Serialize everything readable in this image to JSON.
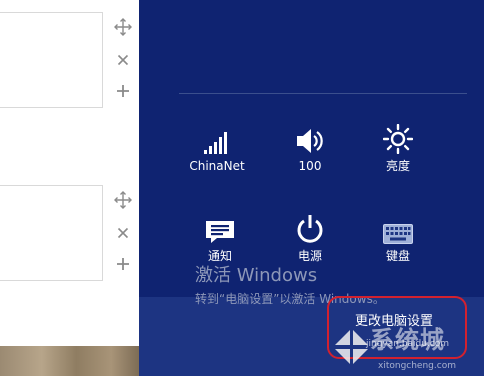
{
  "left_pane": {
    "tile_controls": [
      "move-icon",
      "close-icon",
      "add-icon"
    ]
  },
  "settings_charm": {
    "quick_settings": [
      {
        "label": "ChinaNet",
        "icon": "wifi-signal-icon"
      },
      {
        "label": "100",
        "icon": "volume-icon"
      },
      {
        "label": "亮度",
        "icon": "brightness-icon"
      },
      {
        "label": "通知",
        "icon": "notifications-icon"
      },
      {
        "label": "电源",
        "icon": "power-icon"
      },
      {
        "label": "键盘",
        "icon": "keyboard-icon"
      }
    ],
    "change_pc_settings": "更改电脑设置"
  },
  "activation_watermark": {
    "title": "激活 Windows",
    "message": "转到“电脑设置”以激活 Windows。"
  },
  "site_watermark": {
    "brand": "系统城",
    "url_1": "jingyan.baidu.com",
    "url_2": "xitongcheng.com"
  },
  "colors": {
    "charm_background": "#0f2371",
    "bottom_bar": "#1d3482",
    "highlight": "#d2212f"
  }
}
